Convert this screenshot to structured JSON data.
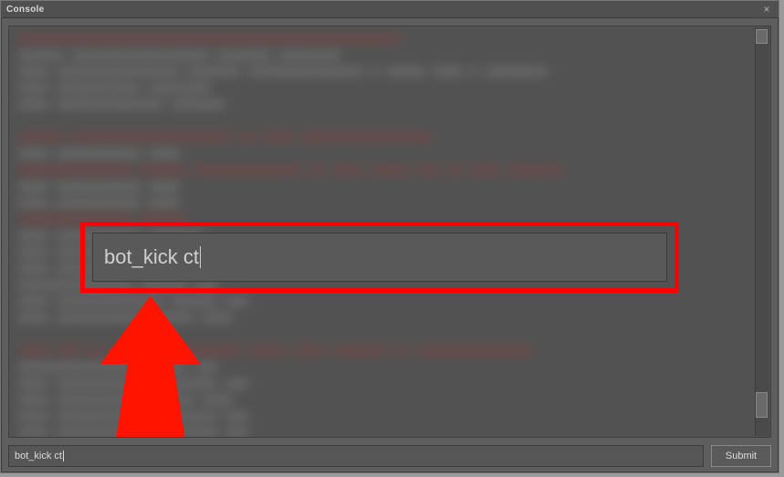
{
  "window": {
    "title": "Console"
  },
  "highlight": {
    "command": "bot_kick ct"
  },
  "footer": {
    "command": "bot_kick ct",
    "submit_label": "Submit"
  },
  "colors": {
    "highlight_border": "#ff0000",
    "arrow": "#ff1400"
  }
}
